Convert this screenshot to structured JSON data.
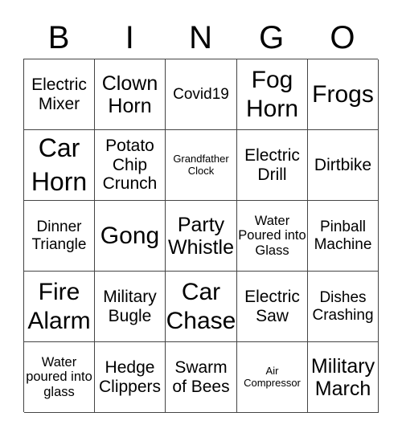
{
  "header": [
    "B",
    "I",
    "N",
    "G",
    "O"
  ],
  "cells": [
    "Electric Mixer",
    "Clown Horn",
    "Covid19",
    "Fog Horn",
    "Frogs",
    "Car Horn",
    "Potato Chip Crunch",
    "Grandfather Clock",
    "Electric Drill",
    "Dirtbike",
    "Dinner Triangle",
    "Gong",
    "Party Whistle",
    "Water Poured into Glass",
    "Pinball Machine",
    "Fire Alarm",
    "Military Bugle",
    "Car Chase",
    "Electric Saw",
    "Dishes Crashing",
    "Water poured into glass",
    "Hedge Clippers",
    "Swarm of Bees",
    "Air Compressor",
    "Military March"
  ]
}
